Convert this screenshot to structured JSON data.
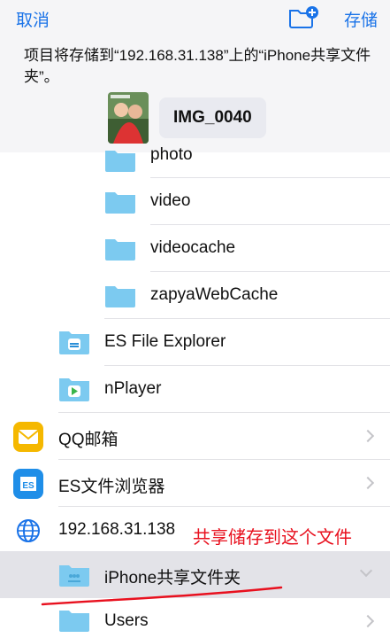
{
  "nav": {
    "cancel": "取消",
    "save": "存储"
  },
  "message": "项目将存储到“192.168.31.138”上的“iPhone共享文件夹”。",
  "file": {
    "name": "IMG_0040"
  },
  "list": {
    "partial": "photo",
    "video": "video",
    "videocache": "videocache",
    "zapya": "zapyaWebCache",
    "es_explorer": "ES File Explorer",
    "nplayer": "nPlayer",
    "qqmail": "QQ邮箱",
    "es_browser": "ES文件浏览器",
    "server": "192.168.31.138",
    "shared": "iPhone共享文件夹",
    "users": "Users"
  },
  "annotation": "共享储存到这个文件",
  "colors": {
    "accent": "#1a73e8",
    "folder": "#7ccaf0",
    "annotation": "#e8101e"
  }
}
